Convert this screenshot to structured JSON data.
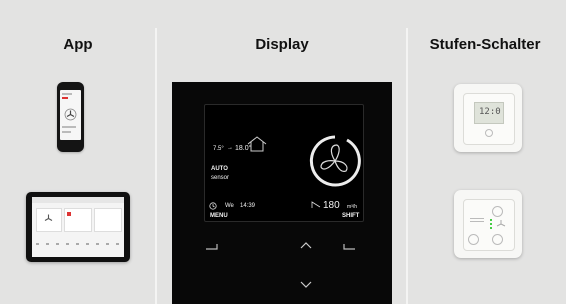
{
  "columns": {
    "app": "App",
    "display": "Display",
    "switch": "Stufen-Schalter"
  },
  "lcd": {
    "outside_temp": "7.5°",
    "arrow": "→",
    "inside_temp": "18.0°",
    "mode": "AUTO",
    "mode_sub": "sensor",
    "day": "We",
    "time": "14:39",
    "airflow_value": "180",
    "airflow_unit": "m³/h",
    "menu_label": "MENU",
    "shift_label": "SHIFT"
  },
  "switch_lcd": {
    "value": "12:0"
  },
  "colors": {
    "background": "#e3e3e2",
    "divider": "#f4f4f3",
    "device": "#080808",
    "lcd_text": "#f2f2f2"
  }
}
